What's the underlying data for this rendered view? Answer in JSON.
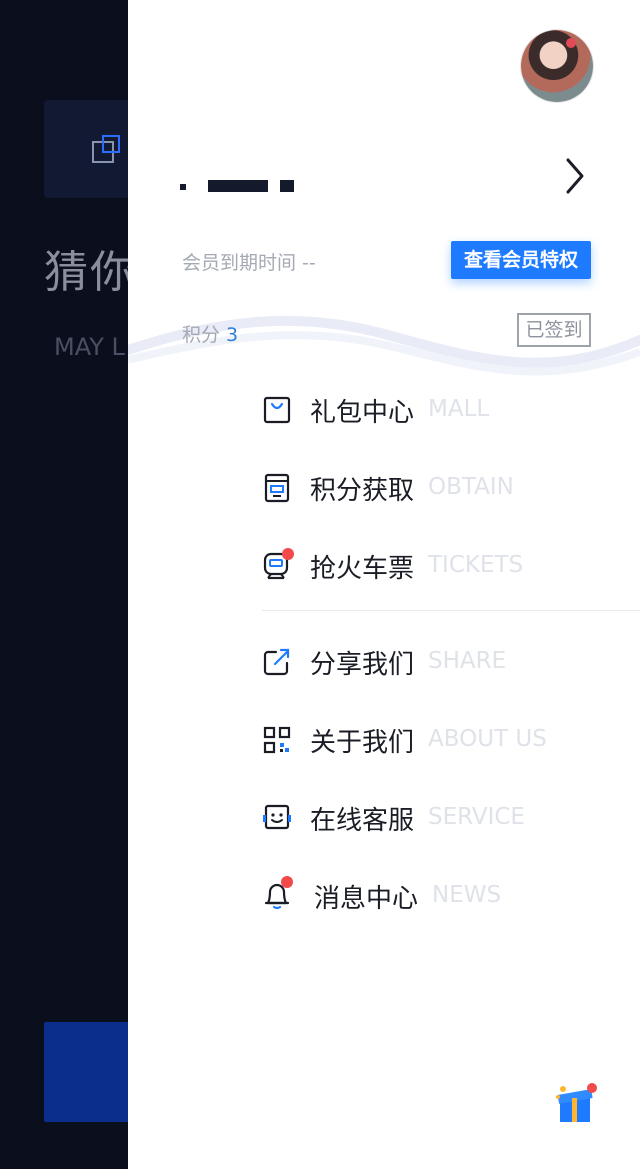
{
  "background": {
    "title": "猜你",
    "subtitle": "MAY L"
  },
  "drawer": {
    "profile": {
      "member_expiry": "会员到期时间  --",
      "member_button": "查看会员特权",
      "points_label": "积分",
      "points_value": "3",
      "signed_label": "已签到"
    },
    "menu": [
      {
        "label": "礼包中心",
        "en": "MALL",
        "icon": "gift-bag-icon"
      },
      {
        "label": "积分获取",
        "en": "OBTAIN",
        "icon": "receipt-icon"
      },
      {
        "label": "抢火车票",
        "en": "TICKETS",
        "icon": "train-icon"
      },
      {
        "label": "分享我们",
        "en": "SHARE",
        "icon": "share-icon"
      },
      {
        "label": "关于我们",
        "en": "ABOUT US",
        "icon": "qr-code-icon"
      },
      {
        "label": "在线客服",
        "en": "SERVICE",
        "icon": "headset-icon"
      },
      {
        "label": "消息中心",
        "en": "NEWS",
        "icon": "bell-icon"
      }
    ]
  },
  "colors": {
    "accent": "#1e7bff",
    "badge_red": "#f24a4a",
    "dark_bg": "#0b0e1c",
    "primary_text": "#1a1d26"
  }
}
